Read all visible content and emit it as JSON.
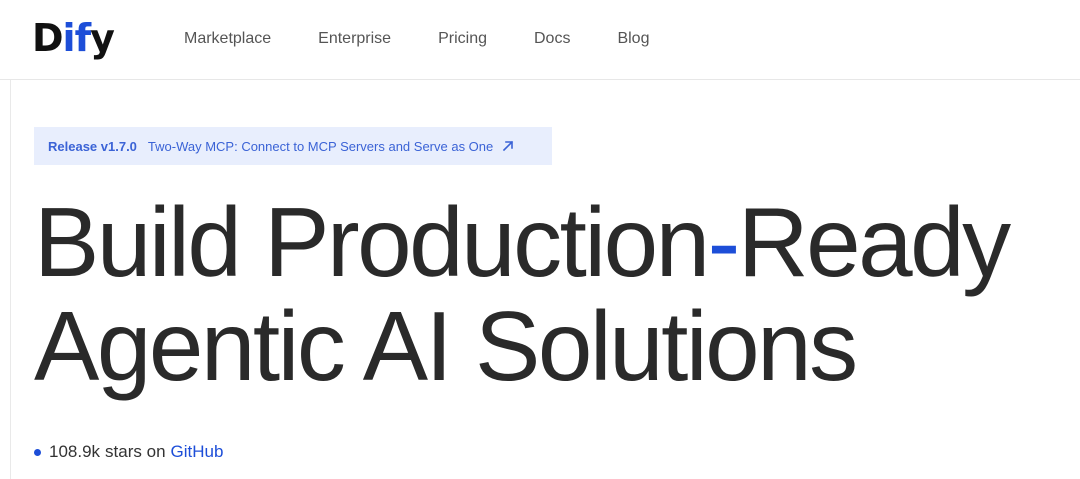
{
  "brand": {
    "logo_prefix": "D",
    "logo_accent": "if",
    "logo_suffix": "y",
    "accent_color": "#1d4ed8"
  },
  "nav": {
    "items": [
      {
        "label": "Marketplace"
      },
      {
        "label": "Enterprise"
      },
      {
        "label": "Pricing"
      },
      {
        "label": "Docs"
      },
      {
        "label": "Blog"
      }
    ]
  },
  "release": {
    "tag": "Release v1.7.0",
    "message": "Two-Way MCP: Connect to MCP Servers and Serve as One",
    "icon": "arrow-up-right-icon"
  },
  "hero": {
    "line1_a": "Build Production",
    "line1_dash": "-",
    "line1_b": "Ready",
    "line2": "Agentic AI Solutions"
  },
  "github": {
    "count": "108.9k",
    "text": "stars on",
    "link": "GitHub"
  }
}
